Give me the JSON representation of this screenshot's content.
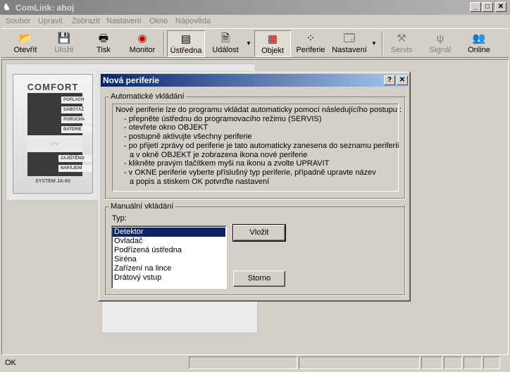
{
  "window": {
    "title": "ComLink: ahoj",
    "icon": "comlink-app-icon",
    "min_glyph": "_",
    "max_glyph": "□",
    "close_glyph": "✕"
  },
  "menu": [
    "Soubor",
    "Upravit",
    "Zobrazit",
    "Nastavení",
    "Okno",
    "Nápověda"
  ],
  "toolbar": {
    "open": {
      "label": "Otevřít",
      "icon": "folder-open-icon"
    },
    "save": {
      "label": "Uložit",
      "icon": "floppy-disk-icon"
    },
    "print": {
      "label": "Tisk",
      "icon": "printer-icon"
    },
    "monitor": {
      "label": "Monitor",
      "icon": "monitor-icon"
    },
    "ustredna": {
      "label": "Ústředna",
      "icon": "control-panel-icon"
    },
    "udalost": {
      "label": "Událost",
      "icon": "document-icon"
    },
    "objekt": {
      "label": "Objekt",
      "icon": "objekt-icon"
    },
    "periferie": {
      "label": "Periferie",
      "icon": "periferie-icon"
    },
    "nastaveni": {
      "label": "Nastavení",
      "icon": "settings-icon"
    },
    "servis": {
      "label": "Servis",
      "icon": "tools-icon"
    },
    "signal": {
      "label": "Signál",
      "icon": "antenna-icon"
    },
    "online": {
      "label": "Online",
      "icon": "users-icon"
    }
  },
  "device": {
    "brand": "COMFORT",
    "indicators": [
      "POPLACH",
      "SABOTÁŽ",
      "PORUCHA",
      "BATERIE"
    ],
    "indicators_bottom": [
      "ZAJIŠTĚNO",
      "NAPÁJENÍ"
    ],
    "model": "SYSTEM JA-60"
  },
  "dialog": {
    "title": "Nová periferie",
    "help_glyph": "?",
    "close_glyph": "✕",
    "auto_group": "Automatické vkládání",
    "auto_lines": [
      "Nové periferie lze do programu vkládat automaticky pomocí následujícího postupu :",
      "   - přepněte ústřednu do programovacího režimu (SERVIS)",
      "   - otevřete okno OBJEKT",
      "   - postupně aktivujte všechny periferie",
      "   - po přijetí zprávy od periferie je tato automaticky zanesena do seznamu periferií",
      "     a v okně OBJEKT je zobrazena ikona nové periferie",
      "   - klikněte pravým tlačítkem myši na ikonu a zvolte UPRAVIT",
      "   - v OKNE periferie vyberte příslušný typ periferie, případně upravte název",
      "     a popis a stiskem OK potvrďte nastavení"
    ],
    "manual_group": "Manuální vkládání",
    "type_label": "Typ:",
    "types": [
      "Detektor",
      "Ovladač",
      "Podřízená ústředna",
      "Siréna",
      "Zařízení na lince",
      "Drátový vstup"
    ],
    "selected_type": "Detektor",
    "insert_button": "Vložit",
    "cancel_button": "Storno"
  },
  "status": {
    "text": "OK"
  }
}
